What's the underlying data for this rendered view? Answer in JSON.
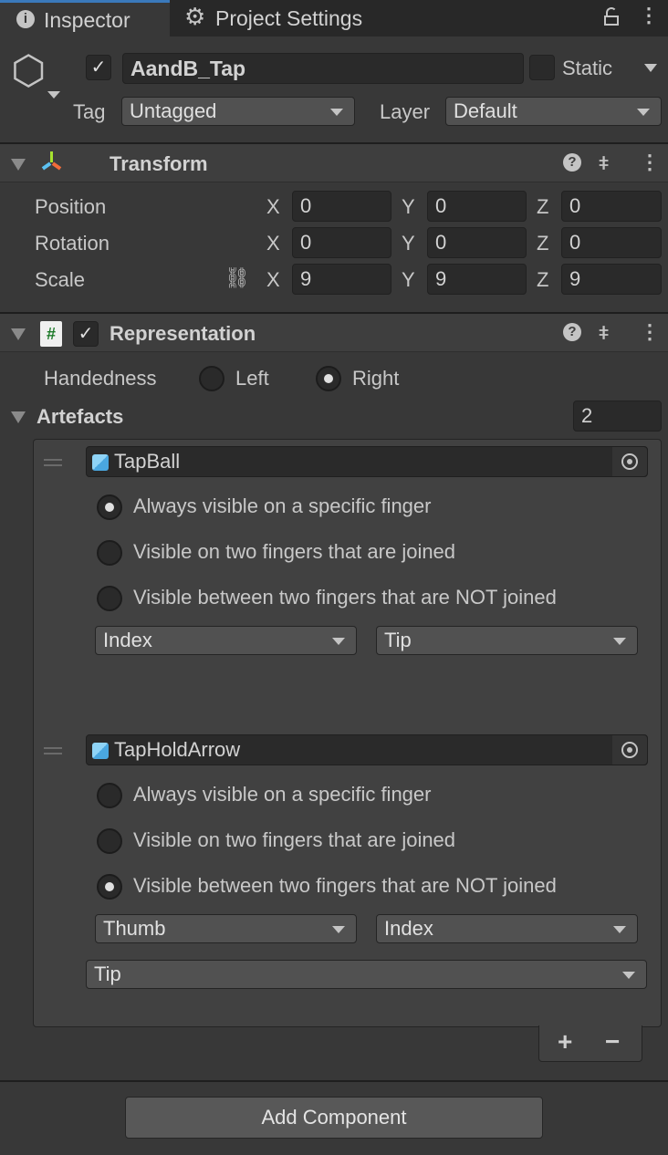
{
  "tabs": [
    {
      "label": "Inspector",
      "icon": "info-icon",
      "active": true
    },
    {
      "label": "Project Settings",
      "icon": "gear-icon",
      "active": false
    }
  ],
  "object": {
    "active": true,
    "name": "AandB_Tap",
    "static_label": "Static",
    "static": false,
    "tag_label": "Tag",
    "tag": "Untagged",
    "layer_label": "Layer",
    "layer": "Default"
  },
  "transform": {
    "title": "Transform",
    "rows": [
      {
        "label": "Position",
        "x": "0",
        "y": "0",
        "z": "0"
      },
      {
        "label": "Rotation",
        "x": "0",
        "y": "0",
        "z": "0"
      },
      {
        "label": "Scale",
        "x": "9",
        "y": "9",
        "z": "9"
      }
    ],
    "axes": {
      "x": "X",
      "y": "Y",
      "z": "Z"
    }
  },
  "representation": {
    "title": "Representation",
    "enabled": true,
    "handedness_label": "Handedness",
    "left": "Left",
    "right": "Right",
    "selected": "Right",
    "artefacts_label": "Artefacts",
    "count": "2",
    "options": [
      "Always visible on a specific finger",
      "Visible on two fingers that are joined",
      "Visible between two fingers that are NOT joined"
    ],
    "items": [
      {
        "object": "TapBall",
        "selected": 0,
        "dd1": "Index",
        "dd2": "Tip"
      },
      {
        "object": "TapHoldArrow",
        "selected": 2,
        "dd1": "Thumb",
        "dd2": "Index",
        "dd3": "Tip"
      }
    ]
  },
  "footer": {
    "add_component": "Add Component",
    "plus": "+",
    "minus": "−"
  },
  "colors": {
    "background": "#383838",
    "tab_accent": "#3a79bb",
    "field": "#2a2a2a"
  }
}
